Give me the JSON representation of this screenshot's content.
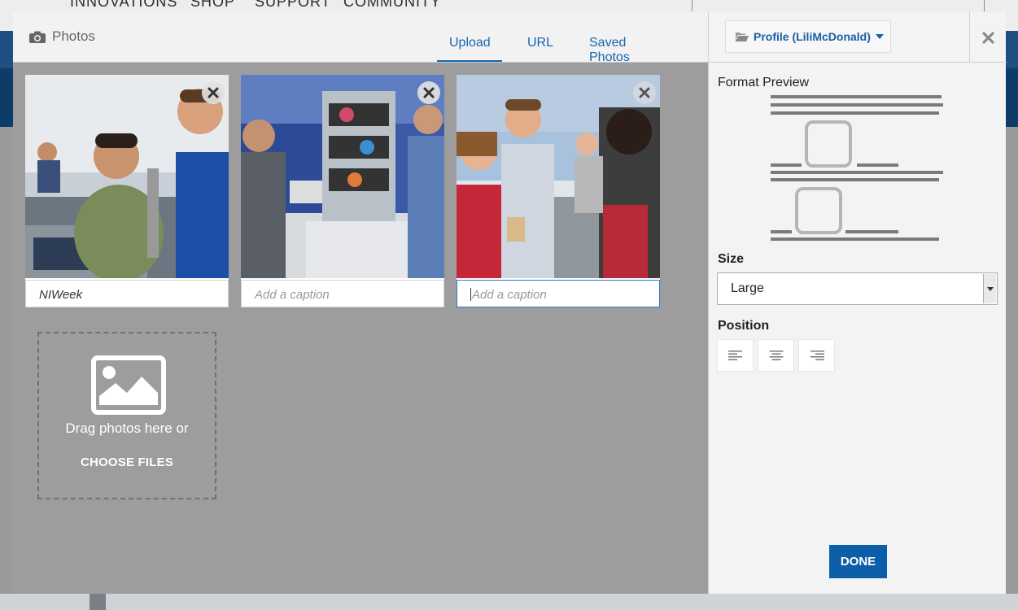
{
  "background_nav": {
    "items": [
      "INNOVATIONS",
      "SHOP",
      "SUPPORT",
      "COMMUNITY"
    ]
  },
  "modal": {
    "title": "Photos",
    "title_icon": "camera-icon",
    "tabs": [
      {
        "label": "Upload",
        "active": true
      },
      {
        "label": "URL",
        "active": false
      },
      {
        "label": "Saved Photos",
        "active": false
      }
    ]
  },
  "photos": [
    {
      "caption": "NIWeek",
      "caption_placeholder": "Add a caption",
      "has_caption": true
    },
    {
      "caption": "",
      "caption_placeholder": "Add a caption",
      "has_caption": false
    },
    {
      "caption": "",
      "caption_placeholder": "Add a caption",
      "has_caption": false,
      "focused": true
    }
  ],
  "dropzone": {
    "text": "Drag photos here or",
    "button_label": "CHOOSE FILES",
    "icon": "image-icon"
  },
  "panel": {
    "profile_label": "Profile (LiliMcDonald)",
    "profile_icon": "folder-open-icon",
    "format_preview_label": "Format Preview",
    "size_label": "Size",
    "size_value": "Large",
    "position_label": "Position",
    "positions": [
      "align-left-icon",
      "align-center-icon",
      "align-right-icon"
    ],
    "done_label": "DONE"
  },
  "colors": {
    "accent": "#1566b0",
    "done_button": "#0d5ea8",
    "overlay": "#9d9d9d",
    "panel": "#f3f3f3"
  }
}
